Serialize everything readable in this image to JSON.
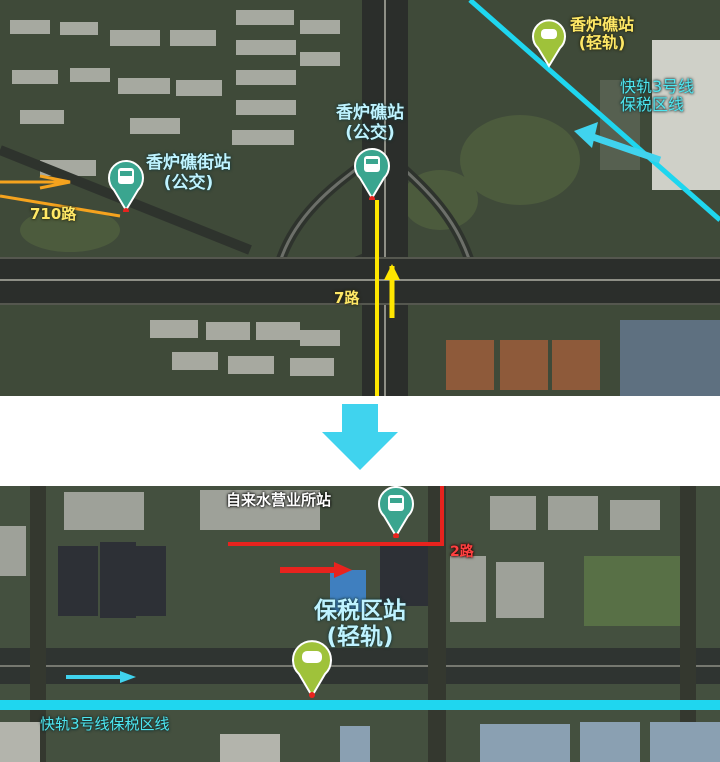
{
  "top_map": {
    "stations": [
      {
        "name": "香炉礁站",
        "type": "(轻轨)",
        "icon": "light-rail-icon"
      },
      {
        "name": "香炉礁站",
        "type": "(公交)",
        "icon": "bus-icon"
      },
      {
        "name": "香炉礁街站",
        "type": "(公交)",
        "icon": "bus-icon"
      }
    ],
    "route_labels": {
      "route_710": "710路",
      "route_7": "7路",
      "line_name_1": "快轨3号线",
      "line_name_2": "保税区线"
    }
  },
  "bottom_map": {
    "stations": [
      {
        "name": "自来水营业所站",
        "icon": "bus-icon"
      },
      {
        "name": "保税区站",
        "type": "(轻轨)",
        "icon": "light-rail-icon"
      }
    ],
    "route_labels": {
      "route_2": "2路",
      "line_name": "快轨3号线保税区线"
    }
  },
  "colors": {
    "rail_line": "#1fd6ef",
    "route_710": "#f5a31e",
    "route_7": "#ffe600",
    "route_2": "#e8231e",
    "bus_pin": "#3aa58f",
    "rail_pin": "#9fc23a",
    "transfer_arrow": "#40d3ee"
  }
}
